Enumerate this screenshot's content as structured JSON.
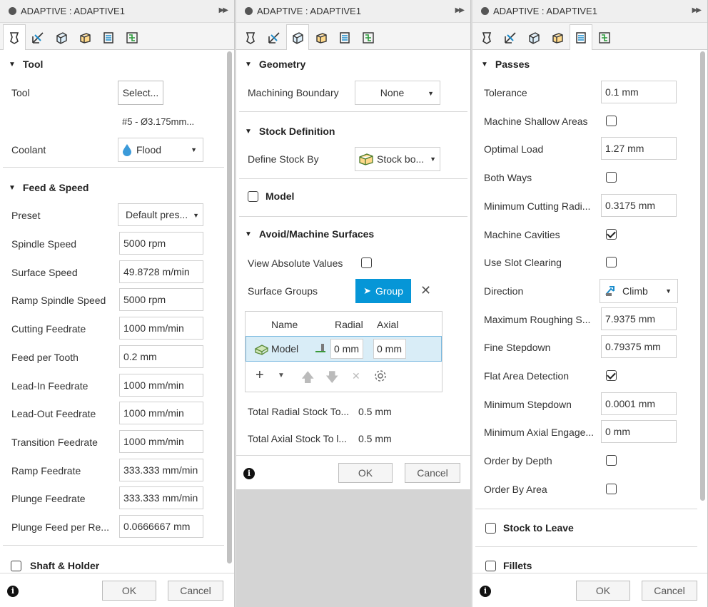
{
  "panels": [
    {
      "title": "ADAPTIVE : ADAPTIVE1",
      "active_tab": 0,
      "tool_section": {
        "header": "Tool",
        "tool_label": "Tool",
        "tool_button": "Select...",
        "tool_desc": "#5 - Ø3.175mm...",
        "coolant_label": "Coolant",
        "coolant_value": "Flood"
      },
      "feed_section": {
        "header": "Feed & Speed",
        "preset_label": "Preset",
        "preset_value": "Default pres...",
        "rows": [
          {
            "label": "Spindle Speed",
            "value": "5000 rpm"
          },
          {
            "label": "Surface Speed",
            "value": "49.8728 m/min"
          },
          {
            "label": "Ramp Spindle Speed",
            "value": "5000 rpm"
          },
          {
            "label": "Cutting Feedrate",
            "value": "1000 mm/min"
          },
          {
            "label": "Feed per Tooth",
            "value": "0.2 mm"
          },
          {
            "label": "Lead-In Feedrate",
            "value": "1000 mm/min"
          },
          {
            "label": "Lead-Out Feedrate",
            "value": "1000 mm/min"
          },
          {
            "label": "Transition Feedrate",
            "value": "1000 mm/min"
          },
          {
            "label": "Ramp Feedrate",
            "value": "333.333 mm/min"
          },
          {
            "label": "Plunge Feedrate",
            "value": "333.333 mm/min"
          },
          {
            "label": "Plunge Feed per Re...",
            "value": "0.0666667 mm"
          }
        ]
      },
      "shaft_section": {
        "header": "Shaft & Holder",
        "checked": false
      },
      "footer": {
        "ok": "OK",
        "cancel": "Cancel"
      }
    },
    {
      "title": "ADAPTIVE : ADAPTIVE1",
      "active_tab": 2,
      "geometry": {
        "header": "Geometry",
        "boundary_label": "Machining Boundary",
        "boundary_value": "None"
      },
      "stock": {
        "header": "Stock Definition",
        "define_label": "Define Stock By",
        "define_value": "Stock bo..."
      },
      "model": {
        "header": "Model",
        "checked": false
      },
      "avoid": {
        "header": "Avoid/Machine Surfaces",
        "abs_label": "View Absolute Values",
        "abs_checked": false,
        "groups_label": "Surface Groups",
        "group_button": "Group",
        "table": {
          "col_name": "Name",
          "col_radial": "Radial",
          "col_axial": "Axial",
          "row_name": "Model",
          "row_radial": "0 mm",
          "row_axial": "0 mm"
        },
        "total_radial_label": "Total Radial Stock To...",
        "total_radial_value": "0.5 mm",
        "total_axial_label": "Total Axial Stock To l...",
        "total_axial_value": "0.5 mm"
      },
      "footer": {
        "ok": "OK",
        "cancel": "Cancel"
      }
    },
    {
      "title": "ADAPTIVE : ADAPTIVE1",
      "active_tab": 4,
      "passes": {
        "header": "Passes",
        "rows": [
          {
            "label": "Tolerance",
            "type": "input",
            "value": "0.1 mm"
          },
          {
            "label": "Machine Shallow Areas",
            "type": "check",
            "checked": false
          },
          {
            "label": "Optimal Load",
            "type": "input",
            "value": "1.27 mm"
          },
          {
            "label": "Both Ways",
            "type": "check",
            "checked": false
          },
          {
            "label": "Minimum Cutting Radi...",
            "type": "input",
            "value": "0.3175 mm"
          },
          {
            "label": "Machine Cavities",
            "type": "check",
            "checked": true
          },
          {
            "label": "Use Slot Clearing",
            "type": "check",
            "checked": false
          },
          {
            "label": "Direction",
            "type": "select",
            "value": "Climb"
          },
          {
            "label": "Maximum Roughing S...",
            "type": "input",
            "value": "7.9375 mm"
          },
          {
            "label": "Fine Stepdown",
            "type": "input",
            "value": "0.79375 mm"
          },
          {
            "label": "Flat Area Detection",
            "type": "check",
            "checked": true
          },
          {
            "label": "Minimum Stepdown",
            "type": "input",
            "value": "0.0001 mm"
          },
          {
            "label": "Minimum Axial Engage...",
            "type": "input",
            "value": "0 mm"
          },
          {
            "label": "Order by Depth",
            "type": "check",
            "checked": false
          },
          {
            "label": "Order By Area",
            "type": "check",
            "checked": false
          }
        ]
      },
      "stock_to_leave": {
        "header": "Stock to Leave",
        "checked": false
      },
      "fillets": {
        "header": "Fillets",
        "checked": false
      },
      "footer": {
        "ok": "OK",
        "cancel": "Cancel"
      }
    }
  ],
  "tab_icons": [
    "tool-tab-icon",
    "geometry-tab-icon",
    "heights-tab-icon",
    "stock-tab-icon",
    "passes-tab-icon",
    "linking-tab-icon"
  ],
  "colors": {
    "accent": "#0696d7",
    "selection": "#d9edf7"
  }
}
